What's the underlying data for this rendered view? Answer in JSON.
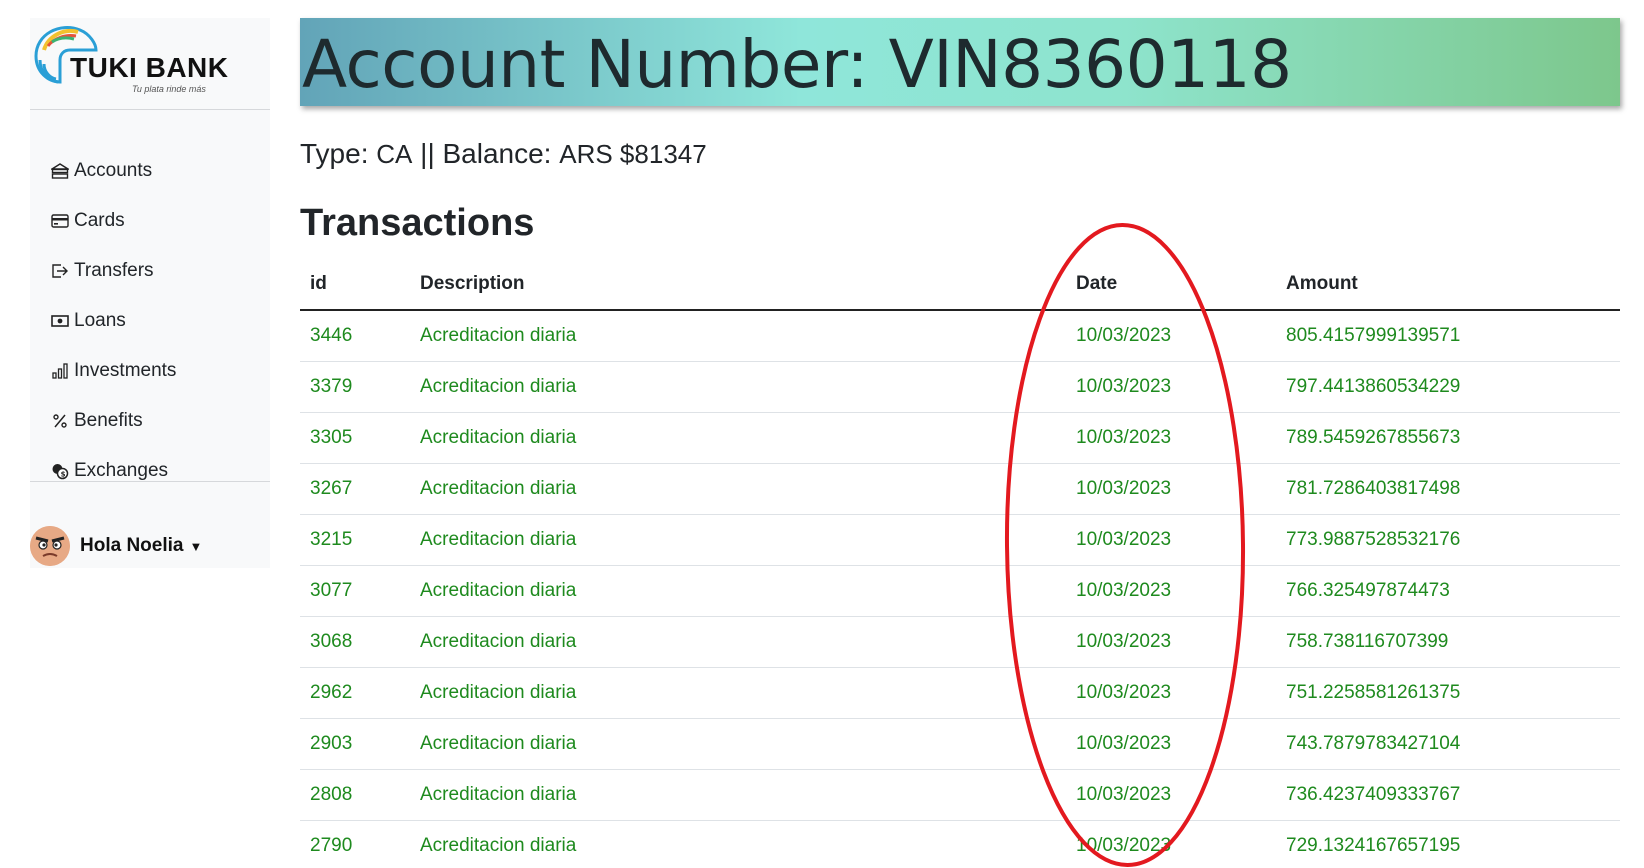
{
  "brand": {
    "name": "TUKI BANK",
    "tagline": "Tu plata rinde más"
  },
  "sidebar": {
    "items": [
      {
        "label": "Accounts",
        "icon": "bank-icon"
      },
      {
        "label": "Cards",
        "icon": "credit-card-icon"
      },
      {
        "label": "Transfers",
        "icon": "transfer-out-icon"
      },
      {
        "label": "Loans",
        "icon": "cash-icon"
      },
      {
        "label": "Investments",
        "icon": "bar-chart-icon"
      },
      {
        "label": "Benefits",
        "icon": "percent-icon"
      },
      {
        "label": "Exchanges",
        "icon": "coins-icon"
      }
    ],
    "user": {
      "greeting": "Hola Noelia"
    }
  },
  "header": {
    "title": "Account Number: VIN8360118"
  },
  "summary": {
    "type_label": "Type:",
    "type_value": "CA",
    "separator": "||",
    "balance_label": "Balance:",
    "balance_value": "ARS $81347"
  },
  "transactions": {
    "title": "Transactions",
    "columns": [
      "id",
      "Description",
      "Date",
      "Amount"
    ],
    "rows": [
      {
        "id": "3446",
        "description": "Acreditacion diaria",
        "date": "10/03/2023",
        "amount": "805.4157999139571"
      },
      {
        "id": "3379",
        "description": "Acreditacion diaria",
        "date": "10/03/2023",
        "amount": "797.4413860534229"
      },
      {
        "id": "3305",
        "description": "Acreditacion diaria",
        "date": "10/03/2023",
        "amount": "789.5459267855673"
      },
      {
        "id": "3267",
        "description": "Acreditacion diaria",
        "date": "10/03/2023",
        "amount": "781.7286403817498"
      },
      {
        "id": "3215",
        "description": "Acreditacion diaria",
        "date": "10/03/2023",
        "amount": "773.9887528532176"
      },
      {
        "id": "3077",
        "description": "Acreditacion diaria",
        "date": "10/03/2023",
        "amount": "766.325497874473"
      },
      {
        "id": "3068",
        "description": "Acreditacion diaria",
        "date": "10/03/2023",
        "amount": "758.738116707399"
      },
      {
        "id": "2962",
        "description": "Acreditacion diaria",
        "date": "10/03/2023",
        "amount": "751.2258581261375"
      },
      {
        "id": "2903",
        "description": "Acreditacion diaria",
        "date": "10/03/2023",
        "amount": "743.7879783427104"
      },
      {
        "id": "2808",
        "description": "Acreditacion diaria",
        "date": "10/03/2023",
        "amount": "736.4237409333767"
      },
      {
        "id": "2790",
        "description": "Acreditacion diaria",
        "date": "10/03/2023",
        "amount": "729.1324167657195"
      }
    ]
  },
  "colors": {
    "row_text": "#1e8a1e",
    "annotation": "#e3191f",
    "banner_start": "#62a4b8",
    "banner_mid": "#8fe6da",
    "banner_end": "#7dc78c"
  }
}
